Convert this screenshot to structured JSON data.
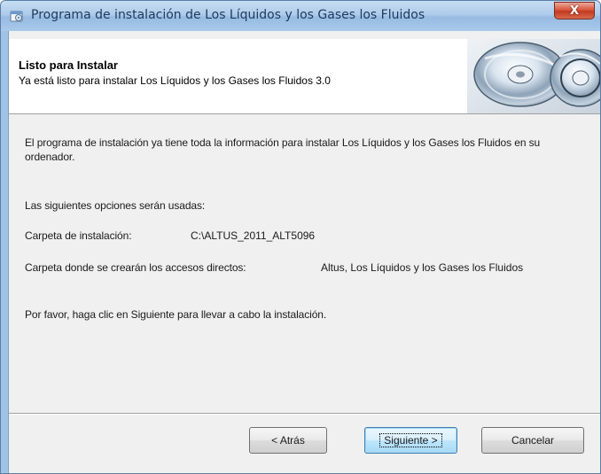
{
  "window": {
    "title": "Programa de instalación de Los Líquidos y los Gases  los Fluidos",
    "close_label": "X"
  },
  "header": {
    "title": "Listo para Instalar",
    "subtitle": "Ya está listo para instalar Los Líquidos y los Gases  los Fluidos 3.0"
  },
  "body": {
    "intro": "El programa de instalación ya tiene toda la información para instalar Los Líquidos y los Gases  los Fluidos en su ordenador.",
    "options_heading": "Las siguientes opciones serán usadas:",
    "install_folder_label": "Carpeta de instalación:",
    "install_folder_value": "C:\\ALTUS_2011_ALT5096",
    "shortcuts_label": "Carpeta donde se crearán los accesos directos:",
    "shortcuts_value": "Altus, Los Líquidos y los Gases  los Fluidos",
    "instruction": "Por favor, haga clic en Siguiente para llevar a cabo la instalación."
  },
  "buttons": {
    "back": "< Atrás",
    "next": "Siguiente >",
    "cancel": "Cancelar"
  },
  "colors": {
    "title_bar": "#aecbea",
    "close_button": "#c23a20",
    "default_button_border": "#3c7fb1"
  },
  "icons": {
    "app": "installer-icon",
    "header": "cd-disc-icon"
  }
}
